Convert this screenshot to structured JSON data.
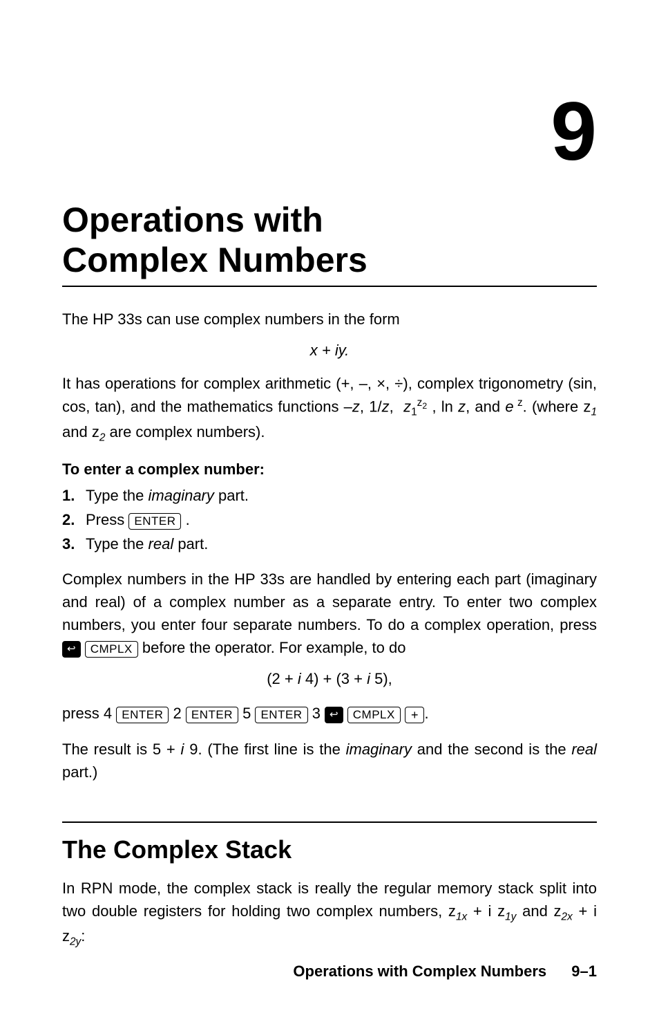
{
  "chapter": {
    "number": "9",
    "title_line1": "Operations with",
    "title_line2": "Complex Numbers"
  },
  "intro": {
    "p1": "The HP 33s can use complex numbers in the form",
    "formula1": "x + iy.",
    "p2_pre": "It has operations for complex arithmetic (+, –, ×, ÷), complex trigonometry (sin, cos, tan), and the mathematics functions –",
    "p2_z": "z",
    "p2_mid1": ", 1/",
    "p2_mid2": ", ",
    "p2_exp_base": "z",
    "p2_exp_sub": "1",
    "p2_exp_sup_pre": "z",
    "p2_exp_sup_sub": "2",
    "p2_mid3": " , ln ",
    "p2_mid4": ", and ",
    "p2_e": "e",
    "p2_e_sup": " z",
    "p2_mid5": ". (where z",
    "p2_sub1": "1",
    "p2_mid6": " and z",
    "p2_sub2": "2",
    "p2_end": " are complex numbers)."
  },
  "enter": {
    "heading": "To enter a complex number:",
    "step1_pre": "Type the ",
    "step1_em": "imaginary",
    "step1_post": " part.",
    "step2_pre": "Press ",
    "step2_key": "ENTER",
    "step2_post": " .",
    "step3_pre": "Type the ",
    "step3_em": "real",
    "step3_post": " part."
  },
  "para2": {
    "p_pre": "Complex numbers in the HP 33s are handled by entering each part (imaginary and real) of a complex number as a separate entry. To enter two complex numbers, you enter four separate numbers. To do a complex operation, press ",
    "cmplx_key": "CMPLX",
    "p_post": " before the operator. For example, to do",
    "formula2": "(2 + i 4) + (3 + i 5),",
    "press_pre": "press 4 ",
    "k_enter": "ENTER",
    "n2": " 2 ",
    "n5": " 5 ",
    "n3": " 3 ",
    "k_cmplx": "CMPLX",
    "k_plus": "+",
    "press_post": ".",
    "result_pre": "The result is 5 + ",
    "result_i": "i ",
    "result_mid": "9. (The first line is the ",
    "result_em1": "imaginary",
    "result_mid2": " and the second is the ",
    "result_em2": "real",
    "result_post": " part.)"
  },
  "section2": {
    "title": "The Complex Stack",
    "p_pre": "In RPN mode, the complex stack is really the regular memory stack split into two double registers for holding two complex numbers, z",
    "s1": "1x",
    "plus_i": " + i z",
    "s2": "1y",
    "and": " and z",
    "s3": "2x",
    "s4": "2y",
    "colon": ":"
  },
  "footer": {
    "title": "Operations with Complex Numbers",
    "page": "9–1"
  }
}
